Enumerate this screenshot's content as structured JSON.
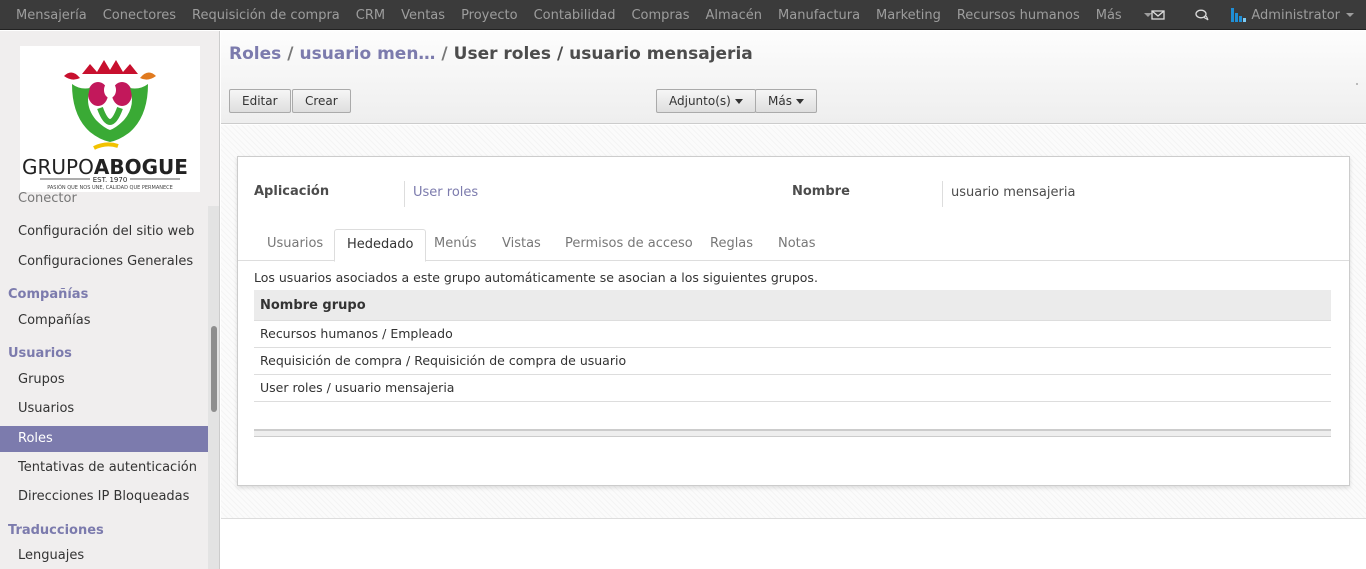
{
  "navbar": {
    "menu": [
      "Mensajería",
      "Conectores",
      "Requisición de compra",
      "CRM",
      "Ventas",
      "Proyecto",
      "Contabilidad",
      "Compras",
      "Almacén",
      "Manufactura",
      "Marketing",
      "Recursos humanos",
      "Más"
    ],
    "user": "Administrator"
  },
  "logo": {
    "brand_left": "GRUPO",
    "brand_right": "ABOGUE",
    "est": "EST. 1970",
    "tagline": "PASIÓN QUE NOS UNE, CALIDAD QUE PERMANECE"
  },
  "sidebar": {
    "partial_item": "Conector",
    "items_top": [
      "Configuración del sitio web",
      "Configuraciones Generales"
    ],
    "section_companies": "Compañías",
    "companies_items": [
      "Compañías"
    ],
    "section_users": "Usuarios",
    "users_items": [
      "Grupos",
      "Usuarios",
      "Roles",
      "Tentativas de autenticación",
      "Direcciones IP Bloqueadas"
    ],
    "section_translations": "Traducciones",
    "translations_items": [
      "Lenguajes"
    ]
  },
  "breadcrumb": {
    "crumb1": "Roles",
    "crumb2": "usuario men…",
    "crumb3": "User roles",
    "current": "usuario mensajeria",
    "sep": "/"
  },
  "buttons": {
    "edit": "Editar",
    "create": "Crear",
    "attachments": "Adjunto(s)",
    "more": "Más"
  },
  "form": {
    "app_label": "Aplicación",
    "app_value": "User roles",
    "name_label": "Nombre",
    "name_value": "usuario mensajeria"
  },
  "tabs": [
    "Usuarios",
    "Hededado",
    "Menús",
    "Vistas",
    "Permisos de acceso",
    "Reglas",
    "Notas"
  ],
  "inherited": {
    "help": "Los usuarios asociados a este grupo automáticamente se asocian a los siguientes grupos.",
    "column": "Nombre grupo",
    "rows": [
      "Recursos humanos / Empleado",
      "Requisición de compra / Requisición de compra de usuario",
      "User roles / usuario mensajeria"
    ]
  },
  "colors": {
    "accent": "#7c7bad",
    "navbar": "#3b3b3b"
  }
}
